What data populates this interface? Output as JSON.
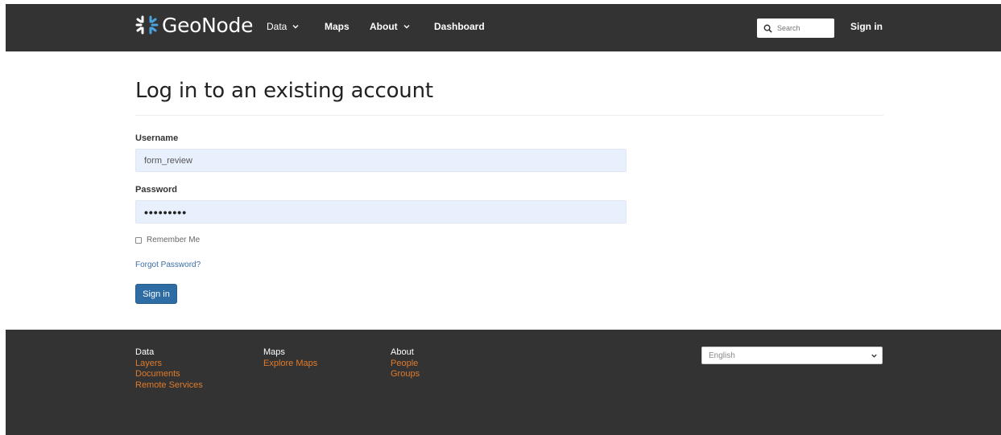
{
  "navbar": {
    "brand": "GeoNode",
    "items": [
      {
        "label": "Data",
        "has_dropdown": true
      },
      {
        "label": "Maps",
        "has_dropdown": false
      },
      {
        "label": "About",
        "has_dropdown": true
      },
      {
        "label": "Dashboard",
        "has_dropdown": false
      }
    ],
    "search_placeholder": "Search",
    "signin_label": "Sign in"
  },
  "main": {
    "title": "Log in to an existing account",
    "username_label": "Username",
    "username_value": "form_review",
    "password_label": "Password",
    "password_masked": "•••••••••",
    "remember_label": "Remember Me",
    "remember_checked": false,
    "forgot_label": "Forgot Password?",
    "submit_label": "Sign in"
  },
  "footer": {
    "columns": [
      {
        "heading": "Data",
        "links": [
          "Layers",
          "Documents",
          "Remote Services"
        ]
      },
      {
        "heading": "Maps",
        "links": [
          "Explore Maps"
        ]
      },
      {
        "heading": "About",
        "links": [
          "People",
          "Groups"
        ]
      }
    ],
    "language_selected": "English"
  },
  "colors": {
    "navbar_bg": "#333333",
    "footer_bg": "#333333",
    "footer_link": "#e07b2b",
    "primary_button": "#2e6da4",
    "input_bg": "#e8f0fe",
    "link": "#3a6ea5"
  }
}
